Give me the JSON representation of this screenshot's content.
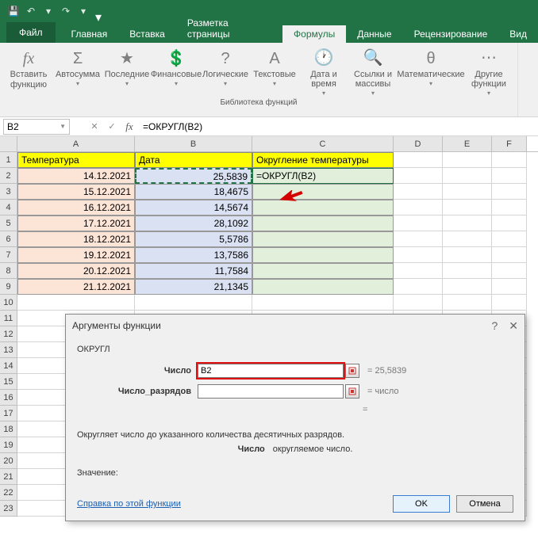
{
  "qat": {
    "save": "💾",
    "undo": "↶",
    "redo": "↷"
  },
  "tabs": {
    "file": "Файл",
    "home": "Главная",
    "insert": "Вставка",
    "layout": "Разметка страницы",
    "formulas": "Формулы",
    "data": "Данные",
    "review": "Рецензирование",
    "view": "Вид"
  },
  "ribbon": {
    "insert_func": "Вставить функцию",
    "autosum": "Автосумма",
    "recent": "Последние",
    "financial": "Финансовые",
    "logical": "Логические",
    "text": "Текстовые",
    "date": "Дата и время",
    "lookup": "Ссылки и массивы",
    "math": "Математические",
    "more": "Другие функции",
    "group_label": "Библиотека функций"
  },
  "namebox": "B2",
  "formula": "=ОКРУГЛ(B2)",
  "columns": [
    "A",
    "B",
    "C",
    "D",
    "E",
    "F"
  ],
  "row_nums": [
    1,
    2,
    3,
    4,
    5,
    6,
    7,
    8,
    9,
    10,
    11,
    12,
    13,
    14,
    15,
    16,
    17,
    18,
    19,
    20,
    21,
    22,
    23
  ],
  "headers": {
    "A": "Температура",
    "B": "Дата",
    "C": "Округление температуры"
  },
  "c2_formula": "=ОКРУГЛ(B2)",
  "rows": [
    {
      "a": "14.12.2021",
      "b": "25,5839"
    },
    {
      "a": "15.12.2021",
      "b": "18,4675"
    },
    {
      "a": "16.12.2021",
      "b": "14,5674"
    },
    {
      "a": "17.12.2021",
      "b": "28,1092"
    },
    {
      "a": "18.12.2021",
      "b": "5,5786"
    },
    {
      "a": "19.12.2021",
      "b": "13,7586"
    },
    {
      "a": "20.12.2021",
      "b": "11,7584"
    },
    {
      "a": "21.12.2021",
      "b": "21,1345"
    }
  ],
  "dialog": {
    "title": "Аргументы функции",
    "func": "ОКРУГЛ",
    "arg1_label": "Число",
    "arg1_value": "B2",
    "arg1_result": "=   25,5839",
    "arg2_label": "Число_разрядов",
    "arg2_result": "=   число",
    "eq": "=",
    "desc": "Округляет число до указанного количества десятичных разрядов.",
    "desc2_label": "Число",
    "desc2_text": "округляемое число.",
    "value_label": "Значение:",
    "help": "Справка по этой функции",
    "ok": "OK",
    "cancel": "Отмена"
  }
}
